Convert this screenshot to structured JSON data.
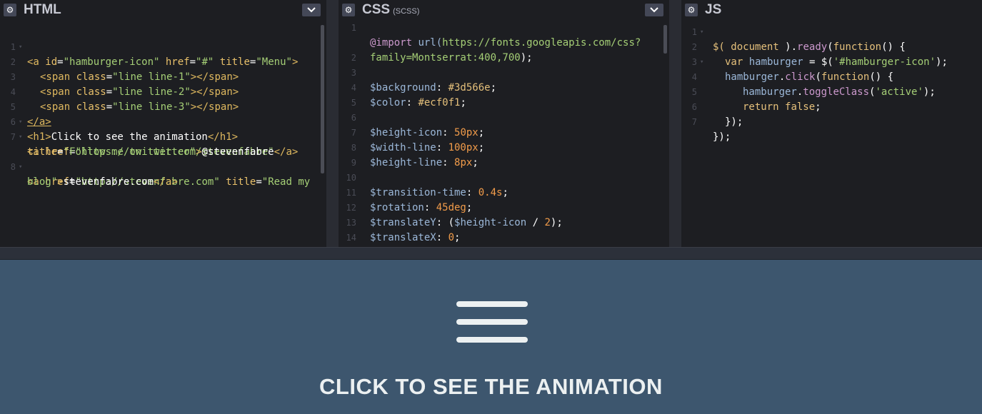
{
  "panels": {
    "html": {
      "title": "HTML",
      "subtitle": ""
    },
    "css": {
      "title": "CSS",
      "subtitle": "(SCSS)"
    },
    "js": {
      "title": "JS",
      "subtitle": ""
    }
  },
  "html_code": [
    {
      "n": "1",
      "fold": "▾"
    },
    {
      "n": "2"
    },
    {
      "n": "3"
    },
    {
      "n": "4"
    },
    {
      "n": "5"
    },
    {
      "n": "6",
      "fold": "▾"
    },
    {
      "n": "7",
      "fold": "▾"
    },
    {
      "n": "8",
      "fold": "▾"
    }
  ],
  "css_line_numbers": [
    "1",
    "2",
    "3",
    "4",
    "5",
    "6",
    "7",
    "8",
    "9",
    "10",
    "11",
    "12",
    "13",
    "14"
  ],
  "js_line_numbers": [
    "1",
    "2",
    "3",
    "4",
    "5",
    "6",
    "7"
  ],
  "code_text": {
    "html": {
      "l1a": "<a ",
      "l1b": "id",
      "l1c": "=",
      "l1d": "\"hamburger-icon\"",
      "l1e": " href",
      "l1f": "=",
      "l1g": "\"#\"",
      "l1h": " title",
      "l1i": "=",
      "l1j": "\"Menu\"",
      "l1k": ">",
      "l2a": "<span ",
      "l2b": "class",
      "l2c": "=",
      "l2d": "\"line line-1\"",
      "l2e": "></span>",
      "l3a": "<span ",
      "l3b": "class",
      "l3c": "=",
      "l3d": "\"line line-2\"",
      "l3e": "></span>",
      "l4a": "<span ",
      "l4b": "class",
      "l4c": "=",
      "l4d": "\"line line-3\"",
      "l4e": "></span>",
      "l5": "</a>",
      "l6a": "<h1>",
      "l6b": "Click to see the animation",
      "l6c": "</h1>",
      "l7a": "<a ",
      "l7b": "href",
      "l7c": "=",
      "l7d": "\"https://twitter.com/stevenfabre\"",
      "l7e": "title",
      "l7f": "=",
      "l7g": "\"Follow me on twitter\"",
      "l7h": ">",
      "l7i": "@stevenfabre",
      "l7j": "</a>",
      "l8a": "<a ",
      "l8b": "href",
      "l8c": "=",
      "l8d": "\"http://stevenfabre.com\"",
      "l8e": " title",
      "l8f": "=",
      "l8g": "\"Read my",
      "l8h": "blog\"",
      "l8i": ">",
      "l8j": "stevenfabre.com",
      "l8k": "</a>"
    },
    "css": {
      "l1a": "@import ",
      "l1b": "url(",
      "l1c": "https://fonts.googleapis.com/css?",
      "l1d": "family=Montserrat:400,700",
      "l1e": ");",
      "l3a": "$background",
      "l3b": ": ",
      "l3c": "#3d566e",
      "l3d": ";",
      "l4a": "$color",
      "l4b": ": ",
      "l4c": "#ecf0f1",
      "l4d": ";",
      "l6a": "$height-icon",
      "l6b": ": ",
      "l6c": "50px",
      "l6d": ";",
      "l7a": "$width-line",
      "l7b": ": ",
      "l7c": "100px",
      "l7d": ";",
      "l8a": "$height-line",
      "l8b": ": ",
      "l8c": "8px",
      "l8d": ";",
      "l10a": "$transition-time",
      "l10b": ": ",
      "l10c": "0.4s",
      "l10d": ";",
      "l11a": "$rotation",
      "l11b": ": ",
      "l11c": "45deg",
      "l11d": ";",
      "l12a": "$translateY",
      "l12b": ": (",
      "l12c": "$height-icon",
      "l12d": " / ",
      "l12e": "2",
      "l12f": ");",
      "l13a": "$translateX",
      "l13b": ": ",
      "l13c": "0",
      "l13d": ";"
    },
    "js": {
      "l1a": "$( ",
      "l1b": "document",
      "l1c": " ).",
      "l1d": "ready",
      "l1e": "(",
      "l1f": "function",
      "l1g": "() {",
      "l2a": "var ",
      "l2b": "hamburger",
      "l2c": " = $(",
      "l2d": "'#hamburger-icon'",
      "l2e": ");",
      "l3a": "hamburger",
      "l3b": ".",
      "l3c": "click",
      "l3d": "(",
      "l3e": "function",
      "l3f": "() {",
      "l4a": "hamburger",
      "l4b": ".",
      "l4c": "toggleClass",
      "l4d": "(",
      "l4e": "'active'",
      "l4f": ");",
      "l5a": "return ",
      "l5b": "false",
      "l5c": ";",
      "l6": "});",
      "l7": "});"
    }
  },
  "preview": {
    "heading": "CLICK TO SEE THE ANIMATION",
    "background": "#3d566e",
    "color": "#ecf0f1"
  },
  "icons": {
    "settings": "gear-icon",
    "collapse": "chevron-down-icon",
    "menu": "hamburger-icon"
  }
}
